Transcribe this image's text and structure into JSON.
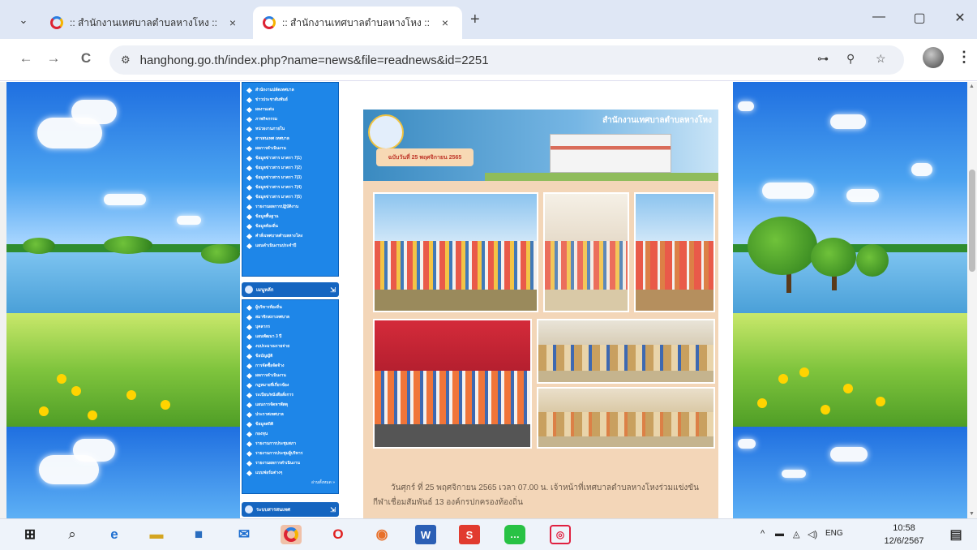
{
  "browser": {
    "tabs": [
      {
        "title": ":: สำนักงานเทศบาลตำบลหางโหง ::",
        "close": "×"
      },
      {
        "title": ":: สำนักงานเทศบาลตำบลหางโหง ::",
        "close": "×"
      }
    ],
    "tab_menu": "⌄",
    "new_tab": "+",
    "url": "hanghong.go.th/index.php?name=news&file=readnews&id=2251",
    "window_controls": {
      "minimize": "—",
      "maximize": "▢",
      "close": "✕"
    },
    "nav": {
      "back": "←",
      "forward": "→",
      "reload": "C"
    }
  },
  "sidebar": {
    "menu_top": [
      "สำนักงานปลัดเทศบาล",
      "ข่าวประชาสัมพันธ์",
      "ผลงานเด่น",
      "ภาพกิจกรรม",
      "หน่วยงานภายใน",
      "สารสนเทศ เทศบาล",
      "ผลการดำเนินงาน",
      "ข้อมูลข่าวสาร มาตรา 7(1)",
      "ข้อมูลข่าวสาร มาตรา 7(2)",
      "ข้อมูลข่าวสาร มาตรา 7(3)",
      "ข้อมูลข่าวสาร มาตรา 7(4)",
      "ข้อมูลข่าวสาร มาตรา 7(5)",
      "รายงานผลการปฏิบัติงาน",
      "ข้อมูลพื้นฐาน",
      "ข้อมูลท้องถิ่น",
      "คำสั่งเทศบาลตำบลหางโหง",
      "แผนดำเนินงานประจำปี"
    ],
    "section2_title": "เมนูหลัก",
    "menu_mid": [
      "ผู้บริหารท้องถิ่น",
      "สมาชิกสภาเทศบาล",
      "บุคลากร",
      "แผนพัฒนา 3 ปี",
      "งบประมาณรายจ่าย",
      "ข้อบัญญัติ",
      "การจัดซื้อจัดจ้าง",
      "ผลการดำเนินงาน",
      "กฎหมายที่เกี่ยวข้อง",
      "ระเบียบ/หนังสือสั่งการ",
      "แผนการจัดหาพัสดุ",
      "ประกาศเทศบาล",
      "ข้อมูลสถิติ",
      "กองทุน",
      "รายงานการประชุมสภา",
      "รายงานการประชุมผู้บริหาร",
      "รายงานผลการดำเนินงาน",
      "แบบฟอร์มต่างๆ"
    ],
    "more_link": "อ่านทั้งหมด »",
    "section3_title": "ระบบสารสนเทศ"
  },
  "news": {
    "banner_org": "สำนักงานเทศบาลตำบลหางโหง",
    "banner_date": "ฉบับวันที่ 25 พฤศจิกายน 2565",
    "text": "วันศุกร์ ที่ 25 พฤศจิกายน 2565 เวลา 07.00 น. เจ้าหน้าที่เทศบาลตำบลหางโหงร่วมแข่งขันกีฬาเชื่อมสัมพันธ์ 13 องค์กรปกครองท้องถิ่น"
  },
  "taskbar": {
    "apps": [
      "start",
      "search",
      "edge",
      "file-explorer",
      "store",
      "mail",
      "chrome",
      "opera",
      "firefox",
      "word",
      "slides",
      "line",
      "camera"
    ],
    "tray": {
      "chevron": "^",
      "lang": "ENG"
    },
    "clock": {
      "time": "10:58",
      "date": "12/6/2567"
    }
  },
  "colors": {
    "tab_strip": "#dfe7f5",
    "menu_blue": "#1e86e8",
    "menu_header": "#1565c0",
    "panel": "#f3d6b8"
  }
}
